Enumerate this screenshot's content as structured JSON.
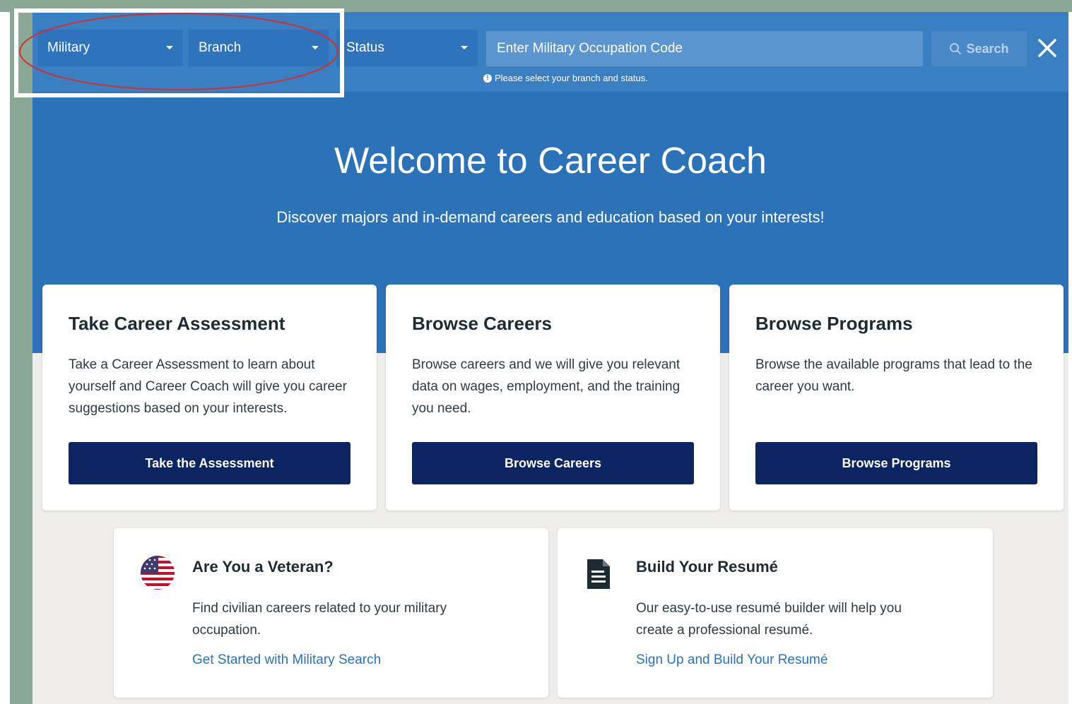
{
  "search": {
    "military_label": "Military",
    "branch_label": "Branch",
    "status_label": "Status",
    "mos_placeholder": "Enter Military Occupation Code",
    "search_label": "Search",
    "hint_text": "Please select your branch and status."
  },
  "hero": {
    "title": "Welcome to Career Coach",
    "subtitle": "Discover majors and in-demand careers and education based on your interests!"
  },
  "cards": [
    {
      "title": "Take Career Assessment",
      "text": "Take a Career Assessment to learn about yourself and Career Coach will give you career suggestions based on your interests.",
      "button": "Take the Assessment"
    },
    {
      "title": "Browse Careers",
      "text": "Browse careers and we will give you relevant data on wages, employment, and the training you need.",
      "button": "Browse Careers"
    },
    {
      "title": "Browse Programs",
      "text": "Browse the available programs that lead to the career you want.",
      "button": "Browse Programs"
    }
  ],
  "veteran": {
    "title": "Are You a Veteran?",
    "text": "Find civilian careers related to your military occupation.",
    "link": "Get Started with Military Search"
  },
  "resume": {
    "title": "Build Your Resumé",
    "text": "Our easy-to-use resumé builder will help you create a professional resumé.",
    "link": "Sign Up and Build Your Resumé"
  },
  "colors": {
    "hero_blue": "#2b72b9",
    "button_navy": "#0c2461",
    "link_blue": "#2b72b9",
    "annotation_red": "#d32f2f"
  }
}
